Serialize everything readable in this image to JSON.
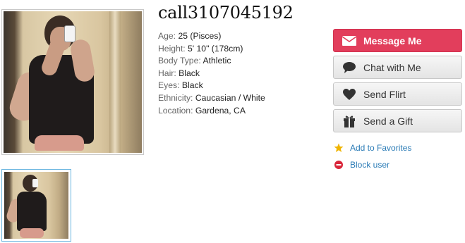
{
  "profile": {
    "username": "call3107045192",
    "details": [
      {
        "label": "Age:",
        "value": "25 (Pisces)"
      },
      {
        "label": "Height:",
        "value": "5' 10\" (178cm)"
      },
      {
        "label": "Body Type:",
        "value": "Athletic"
      },
      {
        "label": "Hair:",
        "value": "Black"
      },
      {
        "label": "Eyes:",
        "value": "Black"
      },
      {
        "label": "Ethnicity:",
        "value": "Caucasian / White"
      },
      {
        "label": "Location:",
        "value": "Gardena, CA"
      }
    ]
  },
  "actions": {
    "message": {
      "label": "Message Me",
      "icon": "envelope-icon"
    },
    "chat": {
      "label": "Chat with Me",
      "icon": "chat-bubble-icon"
    },
    "flirt": {
      "label": "Send Flirt",
      "icon": "heart-icon"
    },
    "gift": {
      "label": "Send a Gift",
      "icon": "gift-icon"
    }
  },
  "links": {
    "favorites": {
      "label": "Add to Favorites",
      "icon": "star-icon"
    },
    "block": {
      "label": "Block user",
      "icon": "block-icon"
    }
  },
  "colors": {
    "primary_button": "#e23e5c",
    "link": "#2a7bb6",
    "thumb_border": "#6cb6e0",
    "star": "#f0b400",
    "block": "#d9263a"
  }
}
